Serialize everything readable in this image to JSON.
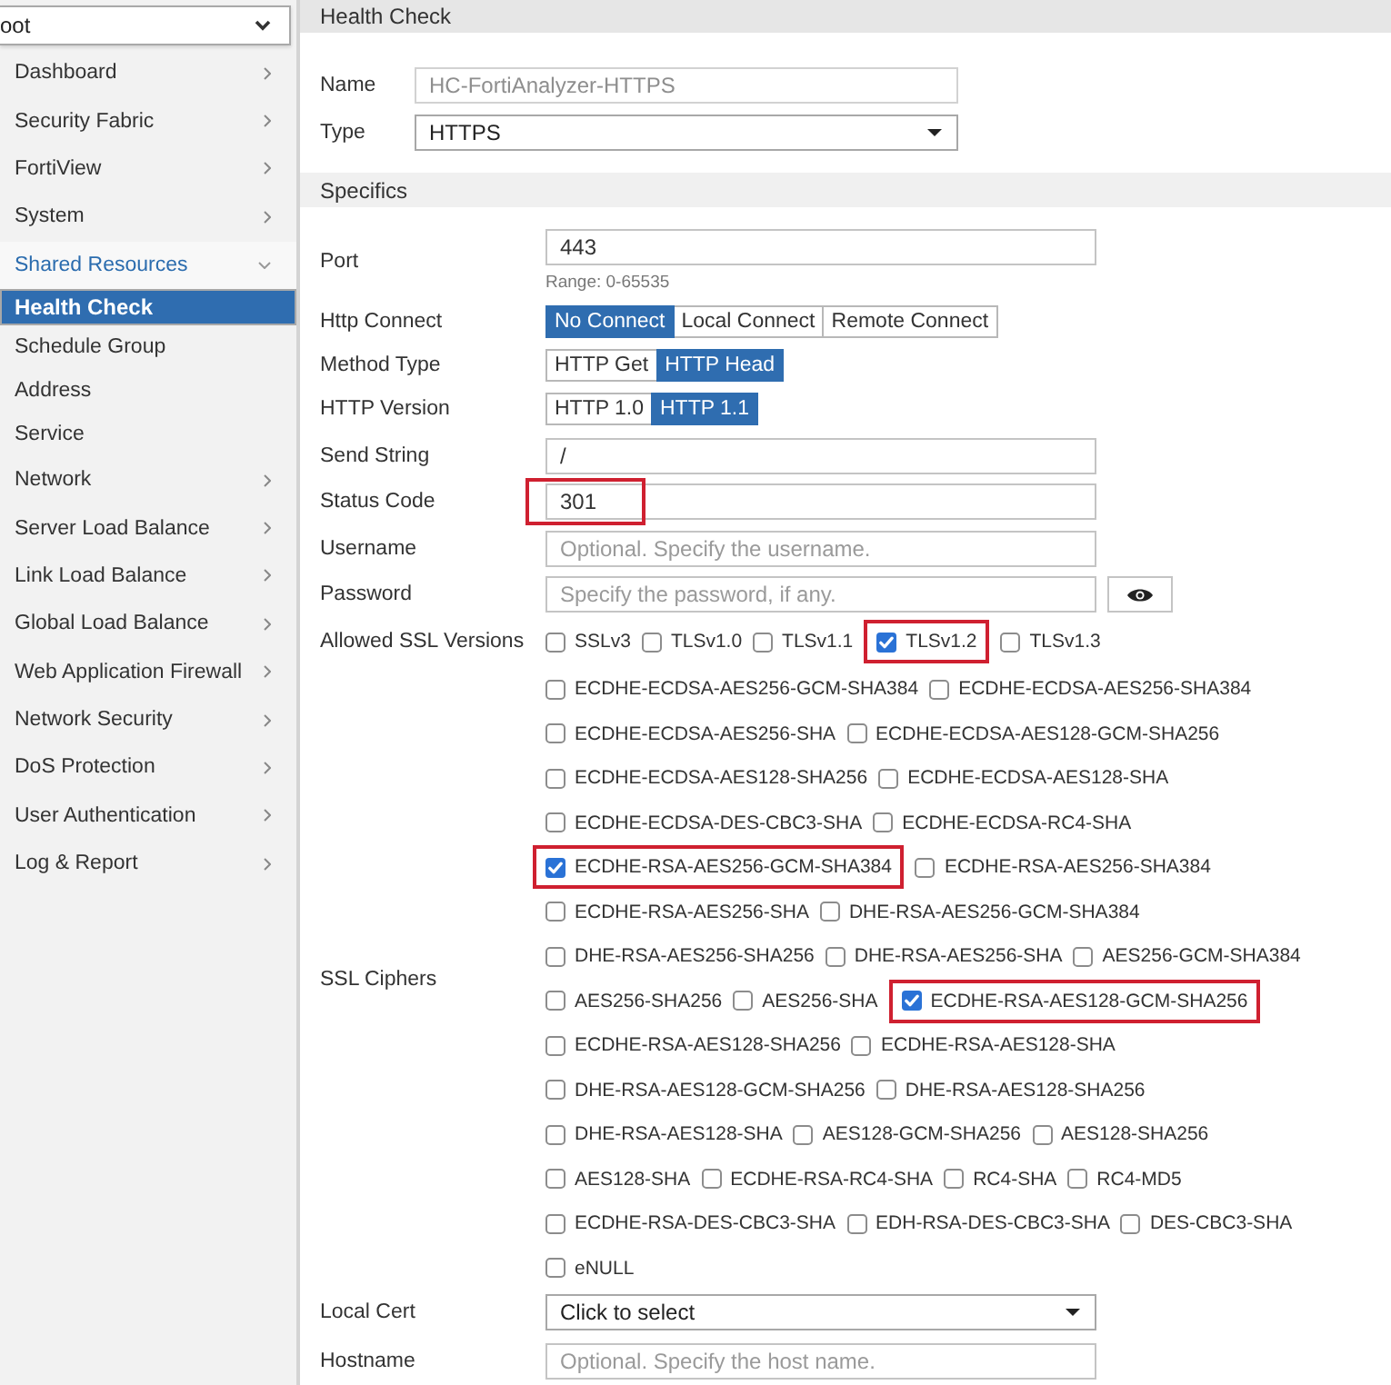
{
  "sidebar": {
    "dropdown": {
      "value": "oot"
    },
    "items": [
      {
        "label": "Dashboard",
        "expanded": false
      },
      {
        "label": "Security Fabric",
        "expanded": false
      },
      {
        "label": "FortiView",
        "expanded": false
      },
      {
        "label": "System",
        "expanded": false
      },
      {
        "label": "Shared Resources",
        "expanded": true,
        "children": [
          {
            "label": "Health Check",
            "selected": true
          },
          {
            "label": "Schedule Group",
            "selected": false
          },
          {
            "label": "Address",
            "selected": false
          },
          {
            "label": "Service",
            "selected": false
          }
        ]
      },
      {
        "label": "Network",
        "expanded": false
      },
      {
        "label": "Server Load Balance",
        "expanded": false
      },
      {
        "label": "Link Load Balance",
        "expanded": false
      },
      {
        "label": "Global Load Balance",
        "expanded": false
      },
      {
        "label": "Web Application Firewall",
        "expanded": false
      },
      {
        "label": "Network Security",
        "expanded": false
      },
      {
        "label": "DoS Protection",
        "expanded": false
      },
      {
        "label": "User Authentication",
        "expanded": false
      },
      {
        "label": "Log & Report",
        "expanded": false
      }
    ]
  },
  "header": {
    "title": "Health Check"
  },
  "general": {
    "name": {
      "label": "Name",
      "value": "HC-FortiAnalyzer-HTTPS",
      "disabled": true
    },
    "type": {
      "label": "Type",
      "value": "HTTPS"
    }
  },
  "specifics": {
    "title": "Specifics",
    "port": {
      "label": "Port",
      "value": "443",
      "hint": "Range: 0-65535"
    },
    "http_connect": {
      "label": "Http Connect",
      "options": [
        {
          "label": "No Connect",
          "selected": true
        },
        {
          "label": "Local Connect",
          "selected": false
        },
        {
          "label": "Remote Connect",
          "selected": false
        }
      ]
    },
    "method_type": {
      "label": "Method Type",
      "options": [
        {
          "label": "HTTP Get",
          "selected": false
        },
        {
          "label": "HTTP Head",
          "selected": true
        }
      ]
    },
    "http_version": {
      "label": "HTTP Version",
      "options": [
        {
          "label": "HTTP 1.0",
          "selected": false
        },
        {
          "label": "HTTP 1.1",
          "selected": true
        }
      ]
    },
    "send_string": {
      "label": "Send String",
      "value": "/"
    },
    "status_code": {
      "label": "Status Code",
      "value": "301",
      "highlighted": true
    },
    "username": {
      "label": "Username",
      "placeholder": "Optional. Specify the username."
    },
    "password": {
      "label": "Password",
      "placeholder": "Specify the password, if any."
    },
    "ssl_versions": {
      "label": "Allowed SSL Versions",
      "options": [
        {
          "name": "SSLv3",
          "checked": false,
          "highlighted": false
        },
        {
          "name": "TLSv1.0",
          "checked": false,
          "highlighted": false
        },
        {
          "name": "TLSv1.1",
          "checked": false,
          "highlighted": false
        },
        {
          "name": "TLSv1.2",
          "checked": true,
          "highlighted": true
        },
        {
          "name": "TLSv1.3",
          "checked": false,
          "highlighted": false
        }
      ]
    },
    "ssl_ciphers": {
      "label": "SSL Ciphers",
      "rows": [
        [
          {
            "name": "ECDHE-ECDSA-AES256-GCM-SHA384",
            "checked": false,
            "highlighted": false
          },
          {
            "name": "ECDHE-ECDSA-AES256-SHA384",
            "checked": false,
            "highlighted": false
          }
        ],
        [
          {
            "name": "ECDHE-ECDSA-AES256-SHA",
            "checked": false,
            "highlighted": false
          },
          {
            "name": "ECDHE-ECDSA-AES128-GCM-SHA256",
            "checked": false,
            "highlighted": false
          }
        ],
        [
          {
            "name": "ECDHE-ECDSA-AES128-SHA256",
            "checked": false,
            "highlighted": false
          },
          {
            "name": "ECDHE-ECDSA-AES128-SHA",
            "checked": false,
            "highlighted": false
          }
        ],
        [
          {
            "name": "ECDHE-ECDSA-DES-CBC3-SHA",
            "checked": false,
            "highlighted": false
          },
          {
            "name": "ECDHE-ECDSA-RC4-SHA",
            "checked": false,
            "highlighted": false
          }
        ],
        [
          {
            "name": "ECDHE-RSA-AES256-GCM-SHA384",
            "checked": true,
            "highlighted": true
          },
          {
            "name": "ECDHE-RSA-AES256-SHA384",
            "checked": false,
            "highlighted": false
          }
        ],
        [
          {
            "name": "ECDHE-RSA-AES256-SHA",
            "checked": false,
            "highlighted": false
          },
          {
            "name": "DHE-RSA-AES256-GCM-SHA384",
            "checked": false,
            "highlighted": false
          }
        ],
        [
          {
            "name": "DHE-RSA-AES256-SHA256",
            "checked": false,
            "highlighted": false
          },
          {
            "name": "DHE-RSA-AES256-SHA",
            "checked": false,
            "highlighted": false
          },
          {
            "name": "AES256-GCM-SHA384",
            "checked": false,
            "highlighted": false
          }
        ],
        [
          {
            "name": "AES256-SHA256",
            "checked": false,
            "highlighted": false
          },
          {
            "name": "AES256-SHA",
            "checked": false,
            "highlighted": false
          },
          {
            "name": "ECDHE-RSA-AES128-GCM-SHA256",
            "checked": true,
            "highlighted": true
          }
        ],
        [
          {
            "name": "ECDHE-RSA-AES128-SHA256",
            "checked": false,
            "highlighted": false
          },
          {
            "name": "ECDHE-RSA-AES128-SHA",
            "checked": false,
            "highlighted": false
          }
        ],
        [
          {
            "name": "DHE-RSA-AES128-GCM-SHA256",
            "checked": false,
            "highlighted": false
          },
          {
            "name": "DHE-RSA-AES128-SHA256",
            "checked": false,
            "highlighted": false
          }
        ],
        [
          {
            "name": "DHE-RSA-AES128-SHA",
            "checked": false,
            "highlighted": false
          },
          {
            "name": "AES128-GCM-SHA256",
            "checked": false,
            "highlighted": false
          },
          {
            "name": "AES128-SHA256",
            "checked": false,
            "highlighted": false
          }
        ],
        [
          {
            "name": "AES128-SHA",
            "checked": false,
            "highlighted": false
          },
          {
            "name": "ECDHE-RSA-RC4-SHA",
            "checked": false,
            "highlighted": false
          },
          {
            "name": "RC4-SHA",
            "checked": false,
            "highlighted": false
          },
          {
            "name": "RC4-MD5",
            "checked": false,
            "highlighted": false
          }
        ],
        [
          {
            "name": "ECDHE-RSA-DES-CBC3-SHA",
            "checked": false,
            "highlighted": false
          },
          {
            "name": "EDH-RSA-DES-CBC3-SHA",
            "checked": false,
            "highlighted": false
          },
          {
            "name": "DES-CBC3-SHA",
            "checked": false,
            "highlighted": false
          }
        ],
        [
          {
            "name": "eNULL",
            "checked": false,
            "highlighted": false
          }
        ]
      ]
    },
    "local_cert": {
      "label": "Local Cert",
      "value": "Click to select"
    },
    "hostname": {
      "label": "Hostname",
      "placeholder": "Optional. Specify the host name."
    }
  }
}
